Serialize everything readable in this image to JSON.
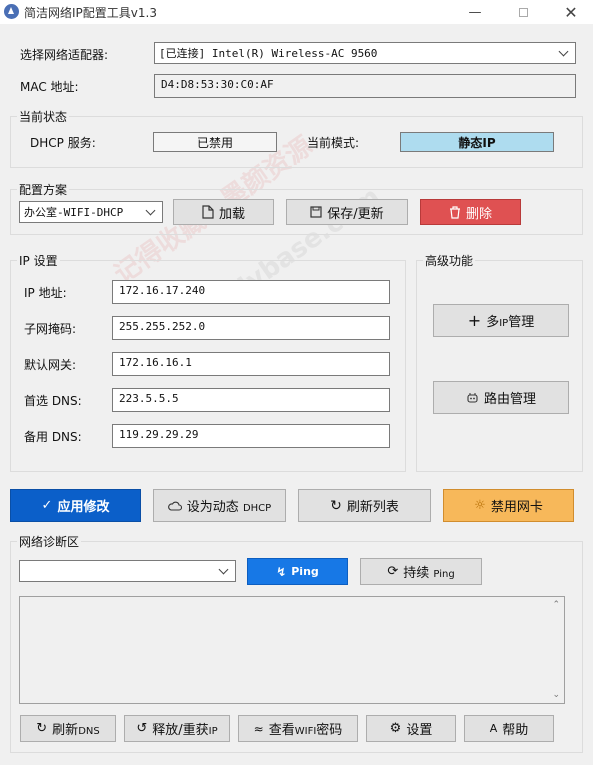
{
  "window": {
    "title": "简洁网络IP配置工具v1.3"
  },
  "adapter": {
    "label": "选择网络适配器:",
    "value": "[已连接] Intel(R) Wireless-AC 9560"
  },
  "mac": {
    "label": "MAC 地址:",
    "value": "D4:D8:53:30:C0:AF"
  },
  "status": {
    "title": "当前状态",
    "dhcp_label": "DHCP 服务:",
    "dhcp_value": "已禁用",
    "mode_label": "当前模式:",
    "mode_value": "静态IP",
    "mode_color": "#aedcef"
  },
  "profile": {
    "title": "配置方案",
    "selected": "办公室-WIFI-DHCP",
    "load_label": "加载",
    "save_label": "保存/更新",
    "delete_label": "删除"
  },
  "ip": {
    "title": "IP 设置",
    "fields": [
      {
        "label": "IP 地址:",
        "value": "172.16.17.240"
      },
      {
        "label": "子网掩码:",
        "value": "255.255.252.0"
      },
      {
        "label": "默认网关:",
        "value": "172.16.16.1"
      },
      {
        "label": "首选 DNS:",
        "value": "223.5.5.5"
      },
      {
        "label": "备用 DNS:",
        "value": "119.29.29.29"
      }
    ]
  },
  "advanced": {
    "title": "高级功能",
    "multi_ip_prefix": "多",
    "multi_ip_small": "IP",
    "multi_ip_suffix": "管理",
    "route_label": "路由管理"
  },
  "actions": {
    "apply_label": "应用修改",
    "dhcp_label": "设为动态",
    "dhcp_small": "DHCP",
    "refresh_label": "刷新列表",
    "disable_label": "禁用网卡",
    "apply_color": "#0b5fc9",
    "disable_color": "#f7b85a"
  },
  "diag": {
    "title": "网络诊断区",
    "target_value": "",
    "ping_label": "Ping",
    "continuous_label": "持续",
    "continuous_small": "Ping",
    "output": ""
  },
  "bottom": {
    "flush_label": "刷新",
    "flush_small": "DNS",
    "release_label": "释放/重获",
    "release_small": "IP",
    "wifi_prefix": "查看",
    "wifi_small": "WIFI",
    "wifi_suffix": "密码",
    "settings_label": "设置",
    "help_label": "帮助"
  },
  "watermark": {
    "text1": "记得收藏：墨颜资源",
    "text2": "Hybase.com"
  }
}
